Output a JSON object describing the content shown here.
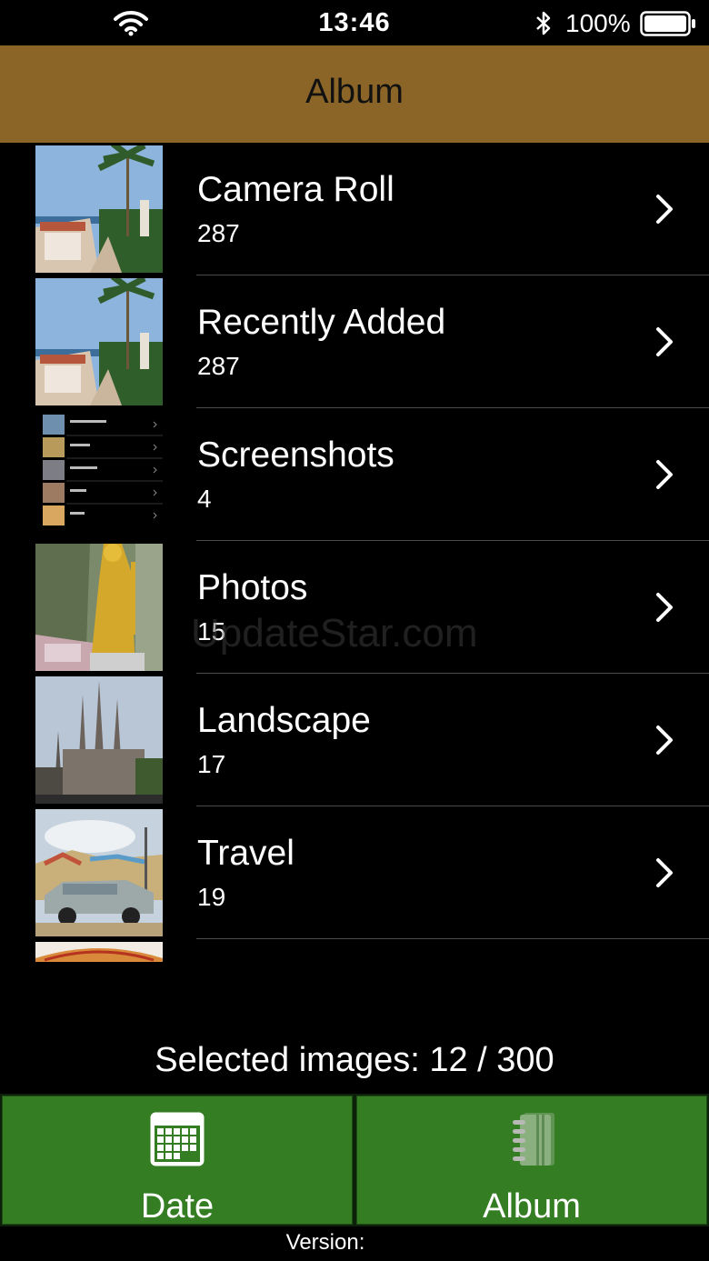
{
  "status_bar": {
    "time": "13:46",
    "battery_text": "100%",
    "icons": [
      "wifi-icon",
      "bluetooth-icon",
      "battery-icon"
    ]
  },
  "nav": {
    "title": "Album"
  },
  "albums": [
    {
      "title": "Camera Roll",
      "count": "287",
      "thumb": "palm-garden"
    },
    {
      "title": "Recently Added",
      "count": "287",
      "thumb": "palm-garden"
    },
    {
      "title": "Screenshots",
      "count": "4",
      "thumb": "screenshot-list"
    },
    {
      "title": "Photos",
      "count": "15",
      "thumb": "golden-statue"
    },
    {
      "title": "Landscape",
      "count": "17",
      "thumb": "cathedral"
    },
    {
      "title": "Travel",
      "count": "19",
      "thumb": "painted-car"
    }
  ],
  "watermark": "UpdateStar.com",
  "selected_info": "Selected images: 12 / 300",
  "tabs": {
    "date": {
      "label": "Date",
      "icon": "calendar-icon"
    },
    "album": {
      "label": "Album",
      "icon": "album-book-icon"
    }
  },
  "version_label": "Version:",
  "colors": {
    "nav_background": "#8a6527",
    "tab_background": "#347d22",
    "page_background": "#000000"
  }
}
